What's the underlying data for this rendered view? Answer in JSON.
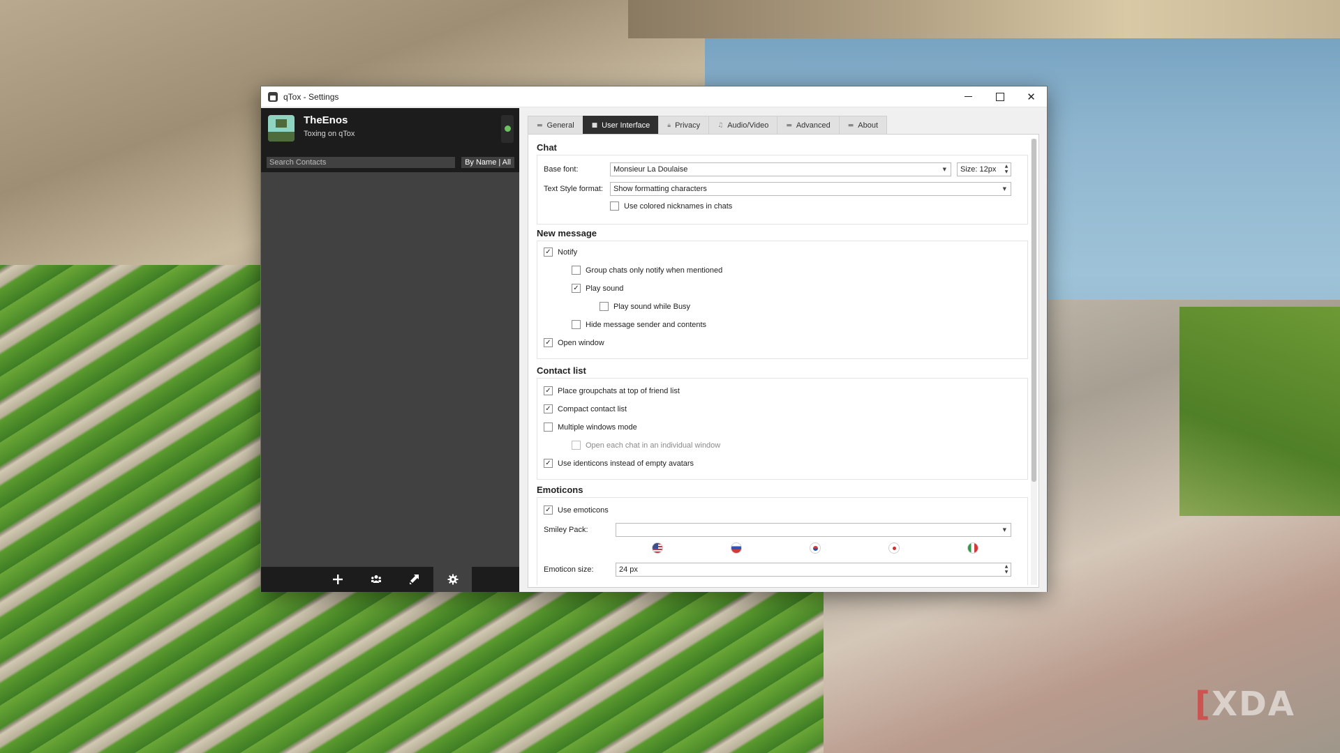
{
  "window": {
    "title": "qTox - Settings"
  },
  "profile": {
    "name": "TheEnos",
    "status_message": "Toxing on qTox"
  },
  "search": {
    "placeholder": "Search Contacts",
    "sort_label": "By Name | All"
  },
  "bottom_bar": {
    "buttons": [
      {
        "icon": "add-icon"
      },
      {
        "icon": "group-icon"
      },
      {
        "icon": "transfer-icon"
      },
      {
        "icon": "gear-icon",
        "active": true
      }
    ]
  },
  "tabs": [
    {
      "label": "General",
      "active": false
    },
    {
      "label": "User Interface",
      "active": true
    },
    {
      "label": "Privacy",
      "active": false
    },
    {
      "label": "Audio/Video",
      "active": false
    },
    {
      "label": "Advanced",
      "active": false
    },
    {
      "label": "About",
      "active": false
    }
  ],
  "chat": {
    "title": "Chat",
    "base_font_label": "Base font:",
    "base_font_value": "Monsieur La Doulaise",
    "size_value": "Size: 12px",
    "text_style_label": "Text Style format:",
    "text_style_value": "Show formatting characters",
    "colored_nicknames": {
      "label": "Use colored nicknames in chats",
      "checked": false
    }
  },
  "new_message": {
    "title": "New message",
    "notify": {
      "label": "Notify",
      "checked": true
    },
    "group_notify": {
      "label": "Group chats only notify when mentioned",
      "checked": false
    },
    "play_sound": {
      "label": "Play sound",
      "checked": true
    },
    "play_sound_busy": {
      "label": "Play sound while Busy",
      "checked": false
    },
    "hide_sender": {
      "label": "Hide message sender and contents",
      "checked": false
    },
    "open_window": {
      "label": "Open window",
      "checked": true
    }
  },
  "contact_list": {
    "title": "Contact list",
    "groupchats_top": {
      "label": "Place groupchats at top of friend list",
      "checked": true
    },
    "compact": {
      "label": "Compact contact list",
      "checked": true
    },
    "multi_window": {
      "label": "Multiple windows mode",
      "checked": false
    },
    "each_chat_window": {
      "label": "Open each chat in an individual window",
      "checked": false,
      "disabled": true
    },
    "identicons": {
      "label": "Use identicons instead of empty avatars",
      "checked": true
    }
  },
  "emoticons": {
    "title": "Emoticons",
    "use_emoticons": {
      "label": "Use emoticons",
      "checked": true
    },
    "smiley_pack_label": "Smiley Pack:",
    "smiley_pack_value": "",
    "preview_flags": [
      "flag-us-icon",
      "flag-ru-icon",
      "flag-kr-icon",
      "flag-jp-icon",
      "flag-it-icon"
    ],
    "size_label": "Emoticon size:",
    "size_value": "24 px"
  },
  "watermark": {
    "text": "XDA"
  },
  "colors": {
    "dark_panel": "#1c1c1c",
    "contact_area": "#414141",
    "active_tab": "#2f2f2f",
    "status_online": "#6bc260"
  }
}
